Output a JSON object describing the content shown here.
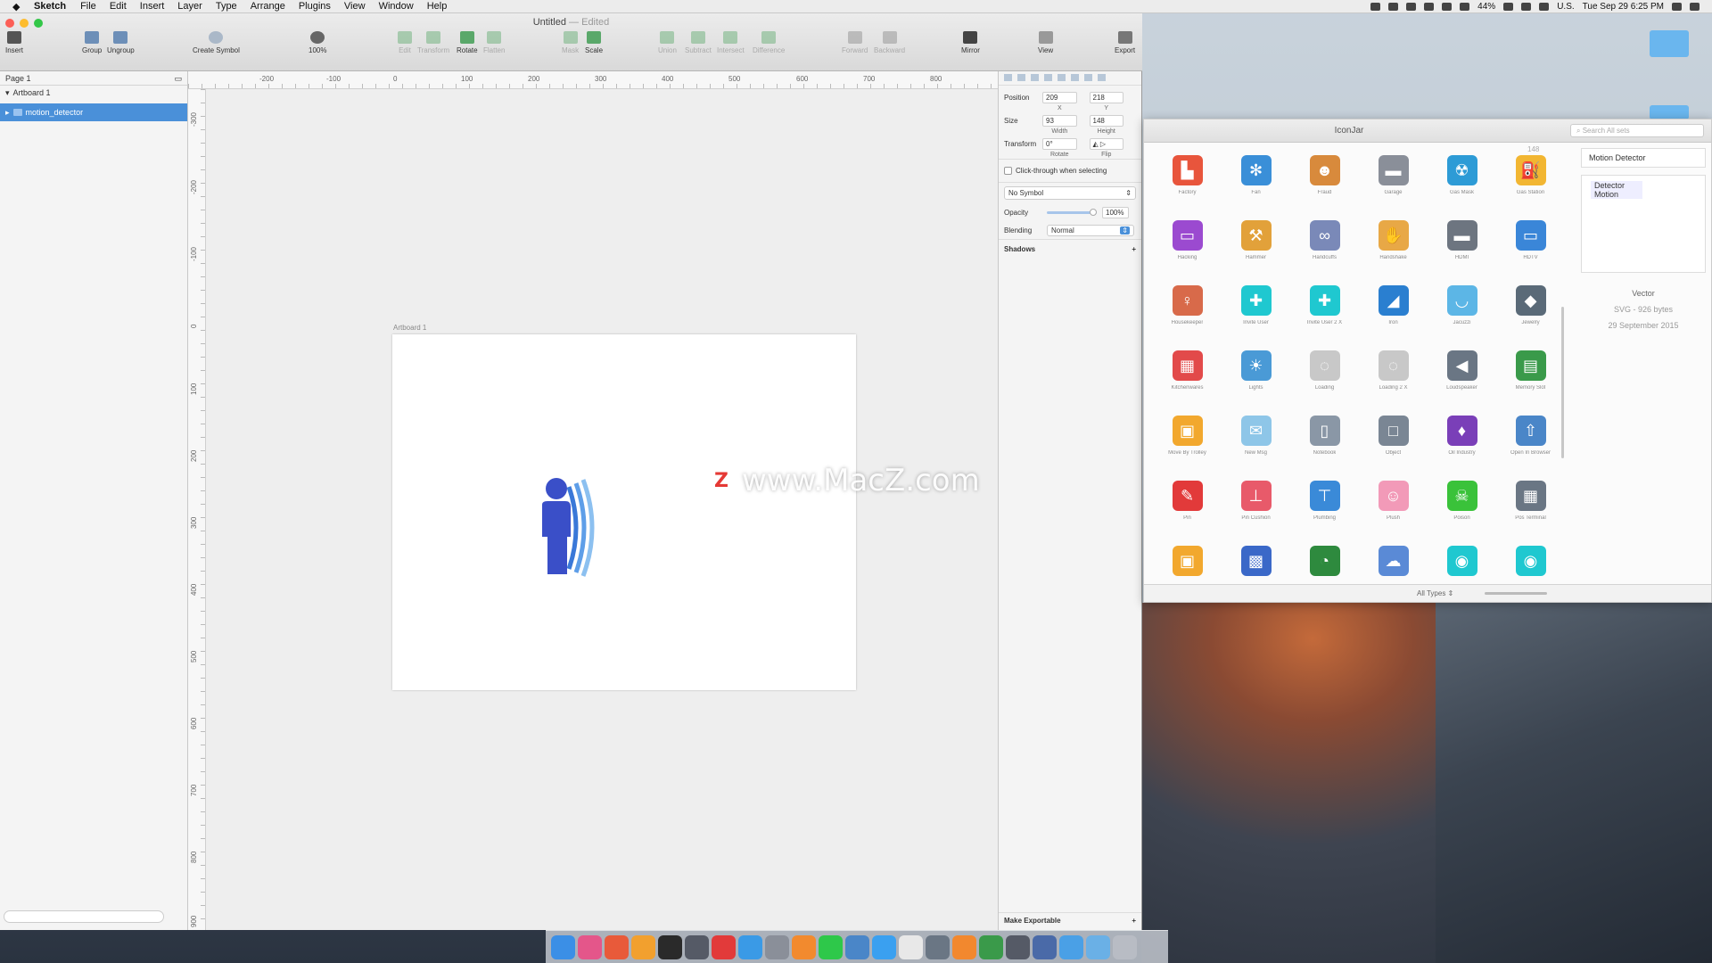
{
  "menubar": {
    "app_name": "Sketch",
    "items": [
      "File",
      "Edit",
      "Insert",
      "Layer",
      "Type",
      "Arrange",
      "Plugins",
      "View",
      "Window",
      "Help"
    ],
    "battery": "44%",
    "locale": "U.S.",
    "datetime": "Tue Sep 29  6:25 PM"
  },
  "sketch": {
    "title": "Untitled",
    "edited_suffix": "— Edited",
    "toolbar": {
      "insert": "Insert",
      "group": "Group",
      "ungroup": "Ungroup",
      "create_symbol": "Create Symbol",
      "zoom": "100%",
      "edit": "Edit",
      "transform": "Transform",
      "rotate": "Rotate",
      "flatten": "Flatten",
      "mask": "Mask",
      "scale": "Scale",
      "union": "Union",
      "subtract": "Subtract",
      "intersect": "Intersect",
      "difference": "Difference",
      "forward": "Forward",
      "backward": "Backward",
      "mirror": "Mirror",
      "view": "View",
      "export": "Export"
    },
    "layers": {
      "page": "Page 1",
      "artboard": "Artboard 1",
      "selected_layer": "motion_detector"
    },
    "ruler_top": [
      "-200",
      "-100",
      "0",
      "100",
      "200",
      "300",
      "400",
      "500",
      "600",
      "700",
      "800"
    ],
    "ruler_left": [
      "-300",
      "-200",
      "-100",
      "0",
      "100",
      "200",
      "300",
      "400",
      "500",
      "600",
      "700",
      "800",
      "900"
    ],
    "artboard_label": "Artboard 1",
    "inspector": {
      "position_label": "Position",
      "pos_x": "209",
      "pos_y": "218",
      "x_label": "X",
      "y_label": "Y",
      "size_label": "Size",
      "width": "93",
      "height": "148",
      "width_label": "Width",
      "height_label": "Height",
      "transform_label": "Transform",
      "rotate_value": "0°",
      "rotate_label": "Rotate",
      "flip_label": "Flip",
      "clickthrough": "Click-through when selecting",
      "symbol": "No Symbol",
      "opacity_label": "Opacity",
      "opacity": "100%",
      "blending_label": "Blending",
      "blending": "Normal",
      "shadows": "Shadows",
      "make_exportable": "Make Exportable"
    }
  },
  "iconjar": {
    "title": "IconJar",
    "search_placeholder": "Search All sets",
    "count": "148",
    "icons": [
      {
        "label": "Factory",
        "color": "#e8553c",
        "glyph": "▙"
      },
      {
        "label": "Fan",
        "color": "#3a8fd8",
        "glyph": "✻"
      },
      {
        "label": "Fraud",
        "color": "#d88a3c",
        "glyph": "☻"
      },
      {
        "label": "Garage",
        "color": "#8a8f99",
        "glyph": "▬"
      },
      {
        "label": "Gas Mask",
        "color": "#2d9bd6",
        "glyph": "☢"
      },
      {
        "label": "Gas Station",
        "color": "#f2b632",
        "glyph": "⛽"
      },
      {
        "label": "Hacking",
        "color": "#9b4ad0",
        "glyph": "▭"
      },
      {
        "label": "Hammer",
        "color": "#e2a13a",
        "glyph": "⚒"
      },
      {
        "label": "Handcuffs",
        "color": "#7a89b8",
        "glyph": "∞"
      },
      {
        "label": "Handshake",
        "color": "#e8a846",
        "glyph": "✋"
      },
      {
        "label": "HDMI",
        "color": "#6d7580",
        "glyph": "▬"
      },
      {
        "label": "HDTV",
        "color": "#3a86d8",
        "glyph": "▭"
      },
      {
        "label": "Housekeeper",
        "color": "#d86a4a",
        "glyph": "♀"
      },
      {
        "label": "Invite User",
        "color": "#1fc8d0",
        "glyph": "✚"
      },
      {
        "label": "Invite User 2 X",
        "color": "#1fc8d0",
        "glyph": "✚"
      },
      {
        "label": "Iron",
        "color": "#2a7fd0",
        "glyph": "◢"
      },
      {
        "label": "Jacuzzi",
        "color": "#5cb6e6",
        "glyph": "◡"
      },
      {
        "label": "Jewelry",
        "color": "#5a6a78",
        "glyph": "◆"
      },
      {
        "label": "Kitchenwares",
        "color": "#e24a4a",
        "glyph": "▦"
      },
      {
        "label": "Lights",
        "color": "#4a9ad6",
        "glyph": "☀"
      },
      {
        "label": "Loading",
        "color": "#c8c8c8",
        "glyph": "◌"
      },
      {
        "label": "Loading 2 X",
        "color": "#c8c8c8",
        "glyph": "◌"
      },
      {
        "label": "Loudspeaker",
        "color": "#6a7684",
        "glyph": "◀"
      },
      {
        "label": "Memory Slot",
        "color": "#3a9a4a",
        "glyph": "▤"
      },
      {
        "label": "Move By Trolley",
        "color": "#f2a82e",
        "glyph": "▣"
      },
      {
        "label": "New Msg",
        "color": "#8ec6e8",
        "glyph": "✉"
      },
      {
        "label": "Notebook",
        "color": "#8a97a6",
        "glyph": "▯"
      },
      {
        "label": "Object",
        "color": "#7a8694",
        "glyph": "□"
      },
      {
        "label": "Oil Industry",
        "color": "#7a3fb8",
        "glyph": "♦"
      },
      {
        "label": "Open In Browser",
        "color": "#4a86c8",
        "glyph": "⇧"
      },
      {
        "label": "Pin",
        "color": "#e23a3a",
        "glyph": "✎"
      },
      {
        "label": "Pin Cushion",
        "color": "#e85a6a",
        "glyph": "⊥"
      },
      {
        "label": "Plumbing",
        "color": "#3a8ad8",
        "glyph": "⊤"
      },
      {
        "label": "Plush",
        "color": "#f29ab8",
        "glyph": "☺"
      },
      {
        "label": "Poison",
        "color": "#3ac23a",
        "glyph": "☠"
      },
      {
        "label": "Pos Terminal",
        "color": "#6a7684",
        "glyph": "▦"
      },
      {
        "label": "",
        "color": "#f2a82e",
        "glyph": "▣"
      },
      {
        "label": "",
        "color": "#3a68c8",
        "glyph": "▩"
      },
      {
        "label": "",
        "color": "#2e8a3e",
        "glyph": "◔"
      },
      {
        "label": "",
        "color": "#5a8ad6",
        "glyph": "☁"
      },
      {
        "label": "",
        "color": "#1fc8d0",
        "glyph": "◉"
      },
      {
        "label": "",
        "color": "#1fc8d0",
        "glyph": "◉"
      }
    ],
    "footer_types": "All Types ⇕",
    "selected_name": "Motion Detector",
    "tags": [
      "Detector",
      "Motion"
    ],
    "kind": "Vector",
    "format": "SVG - 926 bytes",
    "date": "29 September 2015"
  },
  "watermark": {
    "badge": "Z",
    "text": "www.MacZ.com"
  },
  "dock": {
    "colors": [
      "#3b8fe6",
      "#e4568a",
      "#e85a3a",
      "#f2a02e",
      "#2a2a2a",
      "#555a66",
      "#e23a3a",
      "#3a9ae6",
      "#8a8f99",
      "#f28a2e",
      "#2ec84a",
      "#4a86c8",
      "#3aa0f0",
      "#e8e8e8",
      "#6a7684",
      "#f2882e",
      "#3a9a4a",
      "#555a66",
      "#4a6aa8",
      "#4aa0e6",
      "#6ab0e6",
      "#b8bcc4"
    ]
  },
  "colors": {
    "accent": "#4a90d9",
    "motion_icon_body": "#3a4fc8",
    "motion_icon_waves": "#6aa8e8"
  }
}
